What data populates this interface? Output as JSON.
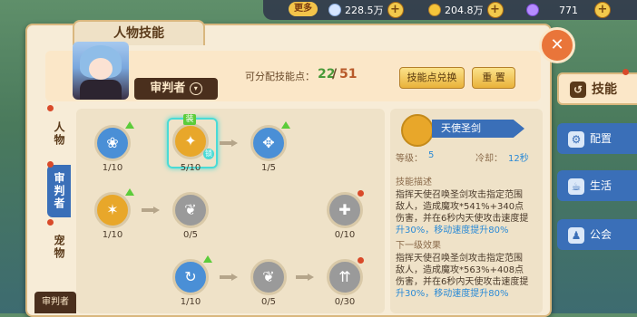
{
  "topbar": {
    "more_label": "更多",
    "resources": [
      {
        "icon": "feather-icon",
        "value": "228.5万",
        "color": "#d6e6ff"
      },
      {
        "icon": "gold-leaf-icon",
        "value": "204.8万",
        "color": "#f5c43a"
      },
      {
        "icon": "purple-crystal-icon",
        "value": "771",
        "color": "#b68cff"
      }
    ],
    "plus_label": "+"
  },
  "window": {
    "title": "人物技能",
    "close_label": "✕"
  },
  "header": {
    "role_name": "审判者",
    "points_label": "可分配技能点：",
    "points_current": "22",
    "points_separator": "/",
    "points_max": "51",
    "exchange_btn": "技能点兑换",
    "reset_btn": "重 置"
  },
  "left_tabs": [
    {
      "label": "人物",
      "active": false
    },
    {
      "label": "审判者",
      "active": true
    },
    {
      "label": "宠物",
      "active": false
    },
    {
      "label": "审判者",
      "active": false
    }
  ],
  "skill_tree": {
    "nodes": [
      {
        "name": "paw-skill",
        "level": "1/10",
        "color": "#4a8fd6"
      },
      {
        "name": "angel-sword-skill",
        "level": "5/10",
        "color": "#e8a72a",
        "selected": true,
        "badge": "装",
        "corner": "锁"
      },
      {
        "name": "wing-sword-skill",
        "level": "1/5",
        "color": "#4a8fd6"
      },
      {
        "name": "phoenix-skill",
        "level": "1/10",
        "color": "#e8a72a"
      },
      {
        "name": "angel-wing-skill",
        "level": "0/5",
        "color": "#9a9a9a"
      },
      {
        "name": "heal-plus-skill",
        "level": "0/10",
        "color": "#9a9a9a"
      },
      {
        "name": "cycle-skill",
        "level": "1/10",
        "color": "#4a8fd6"
      },
      {
        "name": "wing-skill",
        "level": "0/5",
        "color": "#9a9a9a"
      },
      {
        "name": "arrows-up-skill",
        "level": "0/30",
        "color": "#9a9a9a"
      }
    ]
  },
  "detail": {
    "skill_name": "天使圣剑",
    "level_label": "等级：",
    "level_value": "5",
    "cooldown_label": "冷却：",
    "cooldown_value": "12秒",
    "desc_title": "技能描述",
    "desc_lines": [
      "指挥天使召唤圣剑攻击指定范围",
      "敌人，造成魔攻*541%+340点",
      "伤害，并在6秒内天使攻击速度提",
      "升30%，移动速度提升80%"
    ],
    "next_title": "下一级效果",
    "next_lines": [
      "指挥天使召唤圣剑攻击指定范围",
      "敌人，造成魔攻*563%+408点",
      "伤害，并在6秒内天使攻击速度提",
      "升30%，移动速度提升80%"
    ]
  },
  "right_nav": [
    {
      "label": "技能",
      "icon": "skill-icon",
      "active": true
    },
    {
      "label": "配置",
      "icon": "gear-icon",
      "active": false
    },
    {
      "label": "生活",
      "icon": "cup-icon",
      "active": false
    },
    {
      "label": "公会",
      "icon": "guild-icon",
      "active": false
    }
  ]
}
